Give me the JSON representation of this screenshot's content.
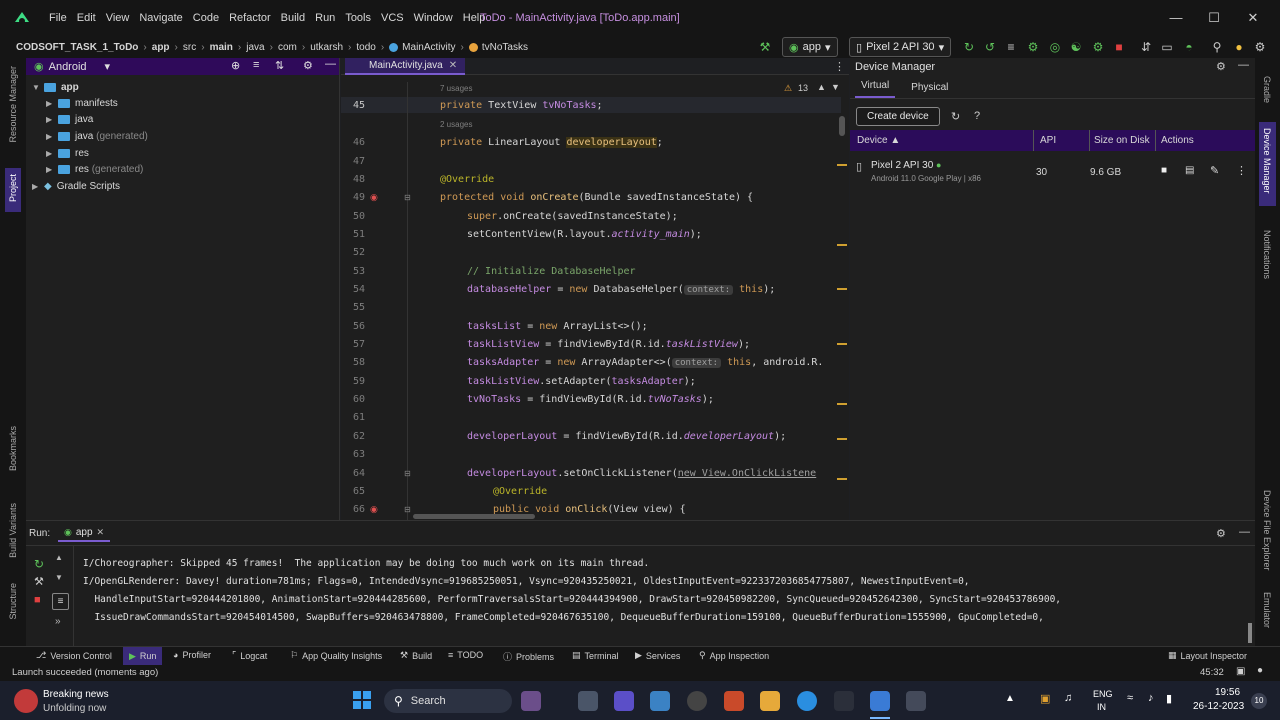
{
  "menu": {
    "items": [
      "File",
      "Edit",
      "View",
      "Navigate",
      "Code",
      "Refactor",
      "Build",
      "Run",
      "Tools",
      "VCS",
      "Window",
      "Help"
    ],
    "window_title": "ToDo - MainActivity.java [ToDo.app.main]"
  },
  "breadcrumb": [
    "CODSOFT_TASK_1_ToDo",
    "app",
    "src",
    "main",
    "java",
    "com",
    "utkarsh",
    "todo",
    "MainActivity",
    "tvNoTasks"
  ],
  "toolbar": {
    "run_config": "app",
    "device": "Pixel 2 API 30"
  },
  "project": {
    "view_mode": "Android",
    "tree": [
      {
        "label": "app",
        "level": 0
      },
      {
        "label": "manifests",
        "level": 1
      },
      {
        "label": "java",
        "level": 1
      },
      {
        "label": "java",
        "suffix": "(generated)",
        "level": 1
      },
      {
        "label": "res",
        "level": 1
      },
      {
        "label": "res",
        "suffix": "(generated)",
        "level": 1
      },
      {
        "label": "Gradle Scripts",
        "level": 0
      }
    ]
  },
  "editor": {
    "tab": "MainActivity.java",
    "warnings": "13",
    "usages_1": "7 usages",
    "usages_2": "2 usages",
    "lines": {
      "l45": "45",
      "l46": "46",
      "l47": "47",
      "l48": "48",
      "l49": "49",
      "l50": "50",
      "l51": "51",
      "l52": "52",
      "l53": "53",
      "l54": "54",
      "l55": "55",
      "l56": "56",
      "l57": "57",
      "l58": "58",
      "l59": "59",
      "l60": "60",
      "l61": "61",
      "l62": "62",
      "l63": "63",
      "l64": "64",
      "l65": "65",
      "l66": "66"
    },
    "code": {
      "c45a": "private ",
      "c45b": "TextView ",
      "c45c": "tvNoTasks",
      "c45d": ";",
      "c46a": "private ",
      "c46b": "LinearLayout ",
      "c46c": "developerLayout",
      "c46d": ";",
      "c48": "@Override",
      "c49a": "protected void ",
      "c49b": "onCreate",
      "c49c": "(Bundle savedInstanceState) {",
      "c50a": "super",
      "c50b": ".onCreate(savedInstanceState);",
      "c51a": "setContentView(R.layout.",
      "c51b": "activity_main",
      "c51c": ");",
      "c53": "// Initialize DatabaseHelper",
      "c54a": "databaseHelper",
      "c54b": " = ",
      "c54c": "new ",
      "c54d": "DatabaseHelper(",
      "c54e": "context:",
      "c54f": " this",
      "c54g": ");",
      "c56a": "tasksList",
      "c56b": " = ",
      "c56c": "new ",
      "c56d": "ArrayList<>();",
      "c57a": "taskListView",
      "c57b": " = findViewById(R.id.",
      "c57c": "taskListView",
      "c57d": ");",
      "c58a": "tasksAdapter",
      "c58b": " = ",
      "c58c": "new ",
      "c58d": "ArrayAdapter<>(",
      "c58e": "context:",
      "c58f": " this",
      "c58g": ", android.R.",
      "c59a": "taskListView",
      "c59b": ".setAdapter(",
      "c59c": "tasksAdapter",
      "c59d": ");",
      "c60a": "tvNoTasks",
      "c60b": " = findViewById(R.id.",
      "c60c": "tvNoTasks",
      "c60d": ");",
      "c62a": "developerLayout",
      "c62b": " = findViewById(R.id.",
      "c62c": "developerLayout",
      "c62d": ");",
      "c64a": "developerLayout",
      "c64b": ".setOnClickListener(",
      "c64c": "new View.OnClickListene",
      "c65": "@Override",
      "c66a": "public void ",
      "c66b": "onClick",
      "c66c": "(View view) {"
    }
  },
  "device_manager": {
    "title": "Device Manager",
    "tabs": [
      "Virtual",
      "Physical"
    ],
    "create_button": "Create device",
    "help": "?",
    "columns": [
      "Device",
      "API",
      "Size on Disk",
      "Actions"
    ],
    "devices": [
      {
        "name": "Pixel 2 API 30",
        "subtitle": "Android 11.0 Google Play | x86",
        "api": "30",
        "size": "9.6 GB"
      }
    ]
  },
  "run_panel": {
    "label": "Run:",
    "tab": "app",
    "log": [
      "I/Choreographer: Skipped 45 frames!  The application may be doing too much work on its main thread.",
      "I/OpenGLRenderer: Davey! duration=781ms; Flags=0, IntendedVsync=919685250051, Vsync=920435250021, OldestInputEvent=9223372036854775807, NewestInputEvent=0,",
      "  HandleInputStart=920444201800, AnimationStart=920444285600, PerformTraversalsStart=920444394900, DrawStart=920450982200, SyncQueued=920452642300, SyncStart=920453786900,",
      "  IssueDrawCommandsStart=920454014500, SwapBuffers=920463478800, FrameCompleted=920467635100, DequeueBufferDuration=159100, QueueBufferDuration=1555900, GpuCompleted=0,"
    ]
  },
  "bottom_tools": [
    "Version Control",
    "Run",
    "Profiler",
    "Logcat",
    "App Quality Insights",
    "Build",
    "TODO",
    "Problems",
    "Terminal",
    "Services",
    "App Inspection",
    "Layout Inspector"
  ],
  "status": {
    "message": "Launch succeeded (moments ago)",
    "position": "45:32"
  },
  "side_labels": {
    "left": [
      "Resource Manager",
      "Project",
      "Bookmarks",
      "Build Variants",
      "Structure"
    ],
    "right": [
      "Gradle",
      "Device Manager",
      "Notifications",
      "Device File Explorer",
      "Emulator"
    ]
  },
  "taskbar": {
    "news_title": "Breaking news",
    "news_sub": "Unfolding now",
    "search": "Search",
    "lang_1": "ENG",
    "lang_2": "IN",
    "time": "19:56",
    "date": "26-12-2023",
    "badge": "10"
  },
  "colors": {
    "accent": "#7a5ccf",
    "panel_header": "#2f0a5a",
    "keyword": "#d09a55"
  }
}
